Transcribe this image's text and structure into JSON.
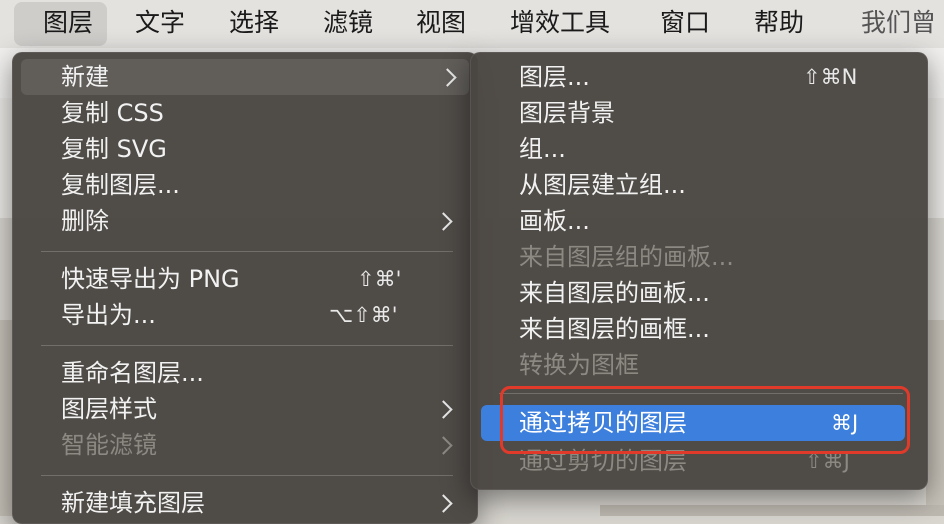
{
  "menubar": [
    "图层",
    "文字",
    "选择",
    "滤镜",
    "视图",
    "增效工具",
    "窗口",
    "帮助",
    "我们曾"
  ],
  "layer_menu": [
    {
      "label": "新建",
      "shortcut": "",
      "arrow": true,
      "disabled": false
    },
    {
      "label": "复制 CSS",
      "shortcut": "",
      "arrow": false,
      "disabled": false
    },
    {
      "label": "复制 SVG",
      "shortcut": "",
      "arrow": false,
      "disabled": false
    },
    {
      "label": "复制图层...",
      "shortcut": "",
      "arrow": false,
      "disabled": false
    },
    {
      "label": "删除",
      "shortcut": "",
      "arrow": true,
      "disabled": false
    },
    {
      "label": "快速导出为 PNG",
      "shortcut": "⇧⌘'",
      "arrow": false,
      "disabled": false
    },
    {
      "label": "导出为...",
      "shortcut": "⌥⇧⌘'",
      "arrow": false,
      "disabled": false
    },
    {
      "label": "重命名图层...",
      "shortcut": "",
      "arrow": false,
      "disabled": false
    },
    {
      "label": "图层样式",
      "shortcut": "",
      "arrow": true,
      "disabled": false
    },
    {
      "label": "智能滤镜",
      "shortcut": "",
      "arrow": true,
      "disabled": true
    },
    {
      "label": "新建填充图层",
      "shortcut": "",
      "arrow": true,
      "disabled": false
    }
  ],
  "new_submenu": [
    {
      "label": "图层...",
      "shortcut": "⇧⌘N",
      "disabled": false,
      "highlighted": false
    },
    {
      "label": "图层背景",
      "shortcut": "",
      "disabled": false,
      "highlighted": false
    },
    {
      "label": "组...",
      "shortcut": "",
      "disabled": false,
      "highlighted": false
    },
    {
      "label": "从图层建立组...",
      "shortcut": "",
      "disabled": false,
      "highlighted": false
    },
    {
      "label": "画板...",
      "shortcut": "",
      "disabled": false,
      "highlighted": false
    },
    {
      "label": "来自图层组的画板...",
      "shortcut": "",
      "disabled": true,
      "highlighted": false
    },
    {
      "label": "来自图层的画板...",
      "shortcut": "",
      "disabled": false,
      "highlighted": false
    },
    {
      "label": "来自图层的画框...",
      "shortcut": "",
      "disabled": false,
      "highlighted": false
    },
    {
      "label": "转换为图框",
      "shortcut": "",
      "disabled": true,
      "highlighted": false
    },
    {
      "label": "通过拷贝的图层",
      "shortcut": "⌘J",
      "disabled": false,
      "highlighted": true
    },
    {
      "label": "通过剪切的图层",
      "shortcut": "⇧⌘J",
      "disabled": true,
      "highlighted": false
    }
  ],
  "colors": {
    "highlight": "#3d7fdc",
    "annotation": "#e03a2a",
    "menu_bg": "#4a4642"
  }
}
